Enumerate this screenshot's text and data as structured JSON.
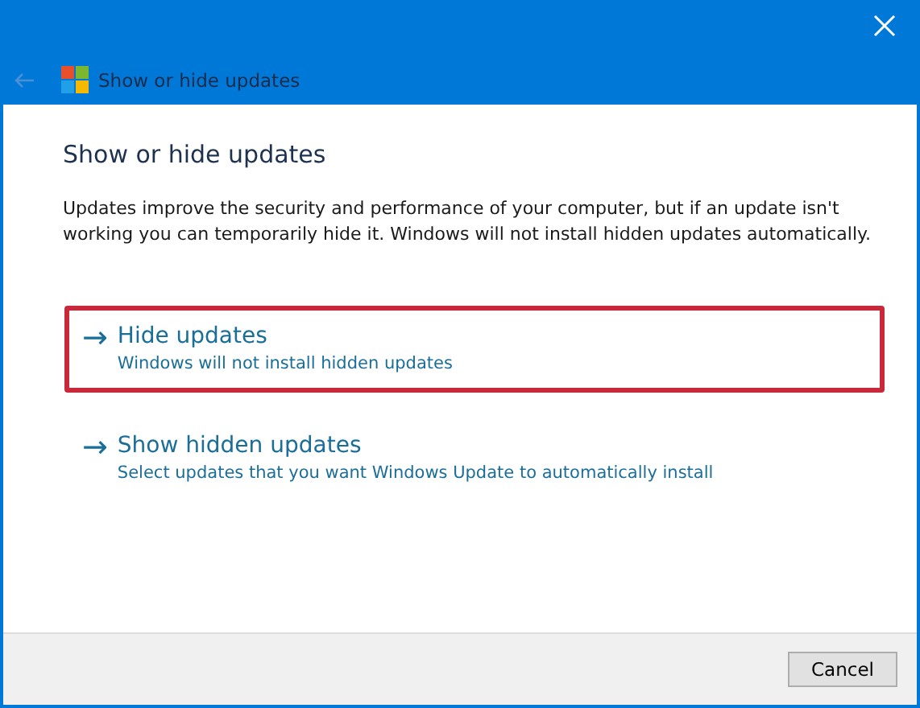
{
  "window": {
    "title": "Show or hide updates"
  },
  "heading": "Show or hide updates",
  "description": "Updates improve the security and performance of your computer, but if an update isn't working you can temporarily hide it. Windows will not install hidden updates automatically.",
  "options": [
    {
      "icon": "→",
      "title": "Hide updates",
      "subtitle": "Windows will not install hidden updates",
      "highlighted": true
    },
    {
      "icon": "→",
      "title": "Show hidden updates",
      "subtitle": "Select updates that you want Windows Update to automatically install",
      "highlighted": false
    }
  ],
  "buttons": [
    "Cancel"
  ]
}
